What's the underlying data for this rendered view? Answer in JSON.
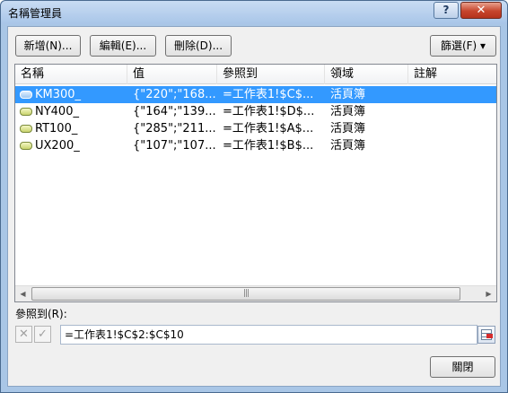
{
  "window": {
    "title": "名稱管理員",
    "help_label": "?",
    "close_label": "✕"
  },
  "toolbar": {
    "new_label": "新增(N)...",
    "edit_label": "編輯(E)...",
    "delete_label": "刪除(D)...",
    "filter_label": "篩選(F) ▾"
  },
  "list": {
    "headers": [
      "名稱",
      "值",
      "參照到",
      "領域",
      "註解"
    ],
    "rows": [
      {
        "name": "KM300_",
        "value": "{\"220\";\"168...",
        "refers": "=工作表1!$C$...",
        "scope": "活頁簿",
        "comment": "",
        "selected": true
      },
      {
        "name": "NY400_",
        "value": "{\"164\";\"139...",
        "refers": "=工作表1!$D$...",
        "scope": "活頁簿",
        "comment": "",
        "selected": false
      },
      {
        "name": "RT100_",
        "value": "{\"285\";\"211...",
        "refers": "=工作表1!$A$...",
        "scope": "活頁簿",
        "comment": "",
        "selected": false
      },
      {
        "name": "UX200_",
        "value": "{\"107\";\"107...",
        "refers": "=工作表1!$B$...",
        "scope": "活頁簿",
        "comment": "",
        "selected": false
      }
    ],
    "scroll_thumb_grip": "|||"
  },
  "refers_to": {
    "label": "參照到(R):",
    "value": "=工作表1!$C$2:$C$10"
  },
  "footer": {
    "close_label": "關閉"
  }
}
